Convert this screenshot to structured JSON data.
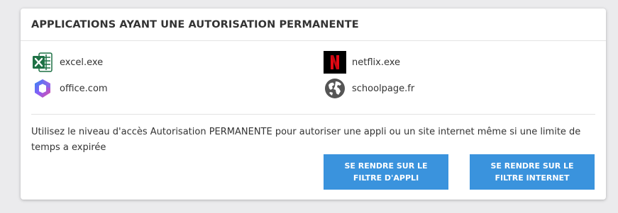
{
  "card": {
    "title": "APPLICATIONS AYANT UNE AUTORISATION PERMANENTE"
  },
  "apps": [
    {
      "name": "excel.exe",
      "icon": "excel-icon"
    },
    {
      "name": "office.com",
      "icon": "office-icon"
    },
    {
      "name": "netflix.exe",
      "icon": "netflix-icon"
    },
    {
      "name": "schoolpage.fr",
      "icon": "globe-icon"
    }
  ],
  "description": "Utilisez le niveau d'accès Autorisation PERMANENTE pour autoriser une appli ou un site internet même si une limite de temps a expirée",
  "buttons": {
    "app_filter": "SE RENDRE SUR LE FILTRE D'APPLI",
    "web_filter": "SE RENDRE SUR LE FILTRE INTERNET"
  },
  "colors": {
    "button": "#3a93dd",
    "excel": "#1e7145",
    "netflix": "#e50914"
  }
}
